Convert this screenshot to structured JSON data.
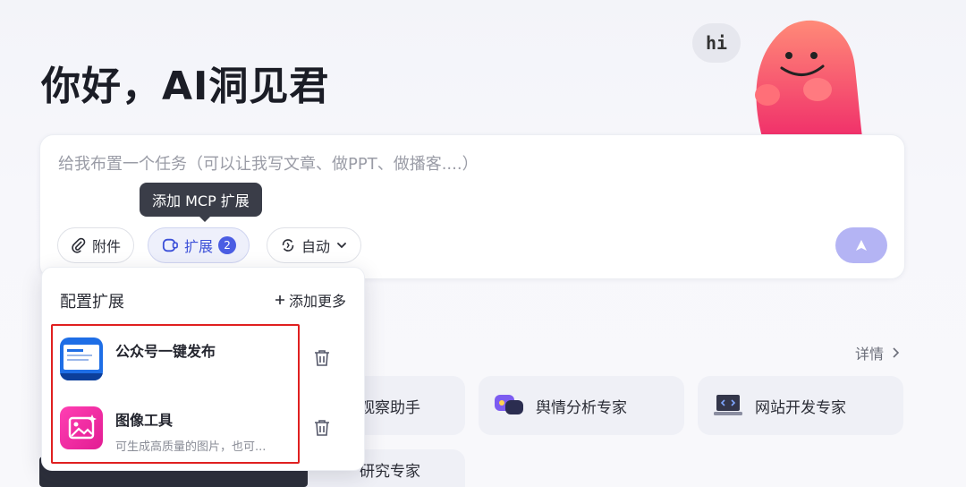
{
  "greeting": "你好，AI洞见君",
  "mascot": {
    "bubble_text": "hi"
  },
  "task": {
    "placeholder": "给我布置一个任务（可以让我写文章、做PPT、做播客....）"
  },
  "tooltip": "添加 MCP 扩展",
  "toolbar": {
    "attach_label": "附件",
    "ext_label": "扩展",
    "ext_count": "2",
    "auto_label": "自动"
  },
  "colors": {
    "accent": "#4a5de3",
    "send": "#b4b4f4",
    "highlight": "#e02020"
  },
  "ext_panel": {
    "title": "配置扩展",
    "add_more": "添加更多",
    "items": [
      {
        "name": "公众号一键发布",
        "desc": "",
        "icon": "wechat-publish-icon"
      },
      {
        "name": "图像工具",
        "desc": "可生成高质量的图片，也可...",
        "icon": "image-tool-icon"
      }
    ]
  },
  "details_label": "详情",
  "agents": [
    {
      "label": "观察助手"
    },
    {
      "label": "舆情分析专家"
    },
    {
      "label": "网站开发专家"
    },
    {
      "label": "研究专家"
    }
  ]
}
